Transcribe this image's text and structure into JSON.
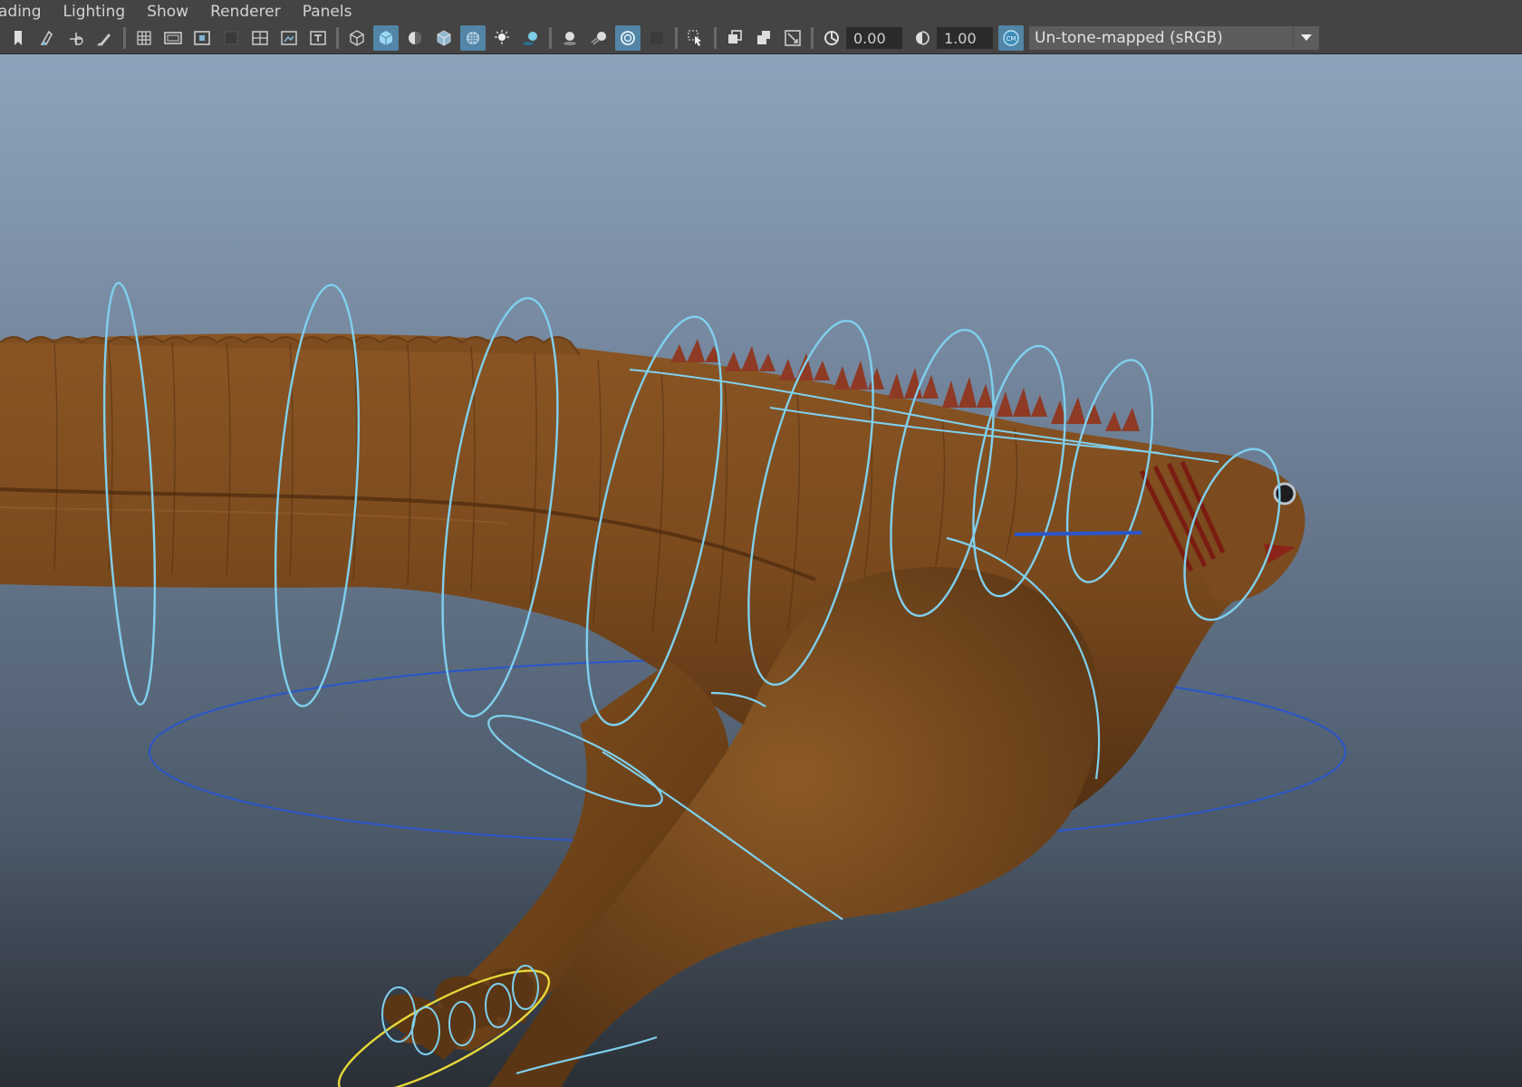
{
  "menubar": {
    "items": [
      "ading",
      "Lighting",
      "Show",
      "Renderer",
      "Panels"
    ]
  },
  "toolbar": {
    "exposure_value": "0.00",
    "gamma_value": "1.00",
    "color_space": "Un-tone-mapped (sRGB)",
    "icons": [
      "bookmark-icon",
      "camera-attribute-icon",
      "tumble-icon",
      "paint-icon",
      "grid-icon",
      "film-gate-icon",
      "resolution-gate-icon",
      "gate-mask-icon",
      "field-chart-icon",
      "safe-action-icon",
      "safe-title-icon",
      "wireframe-icon",
      "smooth-shade-icon",
      "shade-wireframe-icon",
      "textured-icon",
      "xray-icon",
      "lights-icon",
      "shadows-icon",
      "ambient-occlusion-icon",
      "motion-blur-icon",
      "antialias-icon",
      "depth-of-field-icon",
      "isolate-select-icon",
      "xray-joints-icon",
      "xray-active-icon",
      "backface-icon",
      "exposure-icon",
      "gamma-icon",
      "color-management-icon"
    ]
  },
  "colors": {
    "ui_dark": "#444444",
    "active_tool": "#5285a6",
    "control_curve": "#7fd0ee",
    "root_control": "#2a55cc",
    "selected_control": "#e8d838",
    "skin": "#7a4a1e"
  }
}
